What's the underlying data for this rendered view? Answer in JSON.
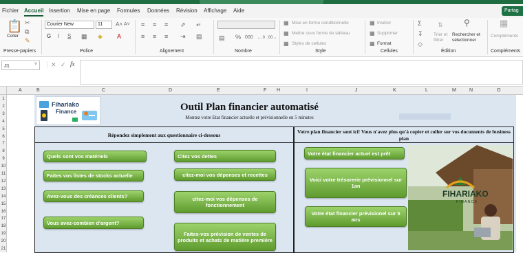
{
  "ribbon_tabs": [
    "Fichier",
    "Accueil",
    "Insertion",
    "Mise en page",
    "Formules",
    "Données",
    "Révision",
    "Affichage",
    "Aide"
  ],
  "share_label": "Partag",
  "clipboard": {
    "paste": "Coller",
    "group": "Presse-papiers"
  },
  "font": {
    "name": "Courier New",
    "size": "11",
    "group": "Police",
    "bold": "G",
    "italic": "I",
    "underline": "S"
  },
  "alignment": {
    "group": "Alignement"
  },
  "number": {
    "group": "Nombre",
    "percent": "%",
    "thousands": "000"
  },
  "styles": {
    "conditional": "Mise en forme conditionnelle",
    "table": "Mettre sous forme de tableau",
    "cell_styles": "Styles de cellules",
    "group": "Style"
  },
  "cells": {
    "insert": "Insérer",
    "delete": "Supprimer",
    "format": "Format",
    "group": "Cellules"
  },
  "editing": {
    "sort": "Trier et filtrer",
    "find": "Rechercher et sélectionner",
    "group": "Édition"
  },
  "addins": {
    "label": "Compléments",
    "group": "Compléments"
  },
  "formula_bar": {
    "cell_ref": "J1",
    "fx": "fx",
    "value": ""
  },
  "columns": [
    "A",
    "B",
    "C",
    "D",
    "E",
    "F",
    "H",
    "I",
    "J",
    "K",
    "L",
    "M",
    "N",
    "O"
  ],
  "rows": [
    "1",
    "2",
    "3",
    "4",
    "5",
    "6",
    "7",
    "8",
    "9",
    "10",
    "11",
    "12",
    "13",
    "14",
    "15",
    "16",
    "17",
    "18",
    "19",
    "20",
    "21"
  ],
  "logo": {
    "line1": "Fihariako",
    "line2": "Finance"
  },
  "sheet": {
    "title": "Outil Plan financier automatisé",
    "subtitle": "Montez votre Etat financier actuelle et prévisionnelle en 5 minutes",
    "left_header": "Répondez simplement aux questionnaire ci-dessous",
    "right_header": "Votre plan financier sont ici! Vous n'avez plus qu'à copier et coller sur vos documents de business plan",
    "left_buttons": [
      "Quels sont vos matériels",
      "Faites vos listes de stocks actuelle",
      "Avez-vous des créances clients?",
      "Vous avez-combien d'argent?"
    ],
    "middle_buttons": [
      "Citez vos dettes",
      "citez-moi vos dépenses et recettes",
      "citez-moi vos dépenses de fonctionnement",
      "Faites-vos prévision de ventes de produits et achats de matière première"
    ],
    "right_buttons": [
      "Votre état financier actuel est prêt",
      "Voici votre trésorerie prévisionnel sur 1an",
      "Votre état financier prévisionel sur 5 ans"
    ]
  },
  "photo_brand": {
    "name": "FIHARIAKO",
    "sub": "FINANCE"
  }
}
